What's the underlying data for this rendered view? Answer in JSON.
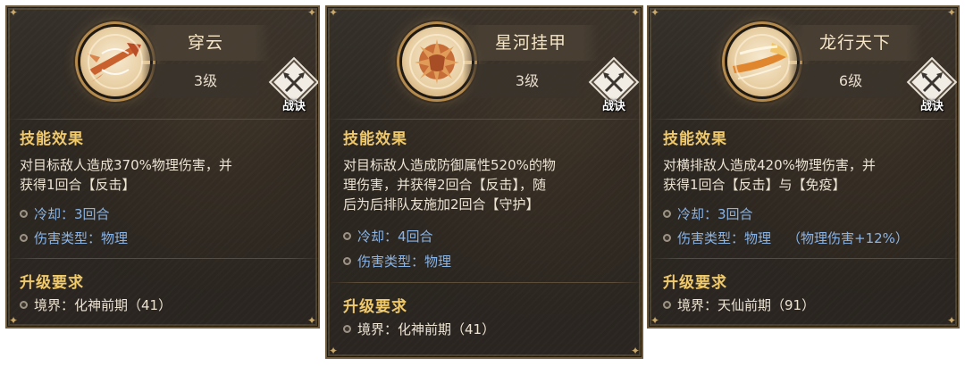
{
  "badge_label": "战诀",
  "section_effect": "技能效果",
  "section_upgrade": "升级要求",
  "cards": [
    {
      "name": "穿云",
      "level": "3级",
      "desc_line1": "对目标敌人造成370%物理伤害，并",
      "desc_line2": "获得1回合【反击】",
      "desc_line3": "",
      "cooldown": "冷却：3回合",
      "damage_type": "伤害类型：物理",
      "damage_extra": "",
      "requirement": "境界：化神前期（41）",
      "emblem_icon": "arrow-spear-icon"
    },
    {
      "name": "星河挂甲",
      "level": "3级",
      "desc_line1": "对目标敌人造成防御属性520%的物",
      "desc_line2": "理伤害，并获得2回合【反击】，随",
      "desc_line3": "后为后排队友施加2回合【守护】",
      "cooldown": "冷却：4回合",
      "damage_type": "伤害类型：物理",
      "damage_extra": "",
      "requirement": "境界：化神前期（41）",
      "emblem_icon": "armor-burst-icon"
    },
    {
      "name": "龙行天下",
      "level": "6级",
      "desc_line1": "对横排敌人造成420%物理伤害，并",
      "desc_line2": "获得1回合【反击】与【免疫】",
      "desc_line3": "",
      "cooldown": "冷却：3回合",
      "damage_type": "伤害类型：物理",
      "damage_extra": "（物理伤害+12%）",
      "requirement": "境界：天仙前期（91）",
      "emblem_icon": "dragon-dash-icon"
    }
  ]
}
